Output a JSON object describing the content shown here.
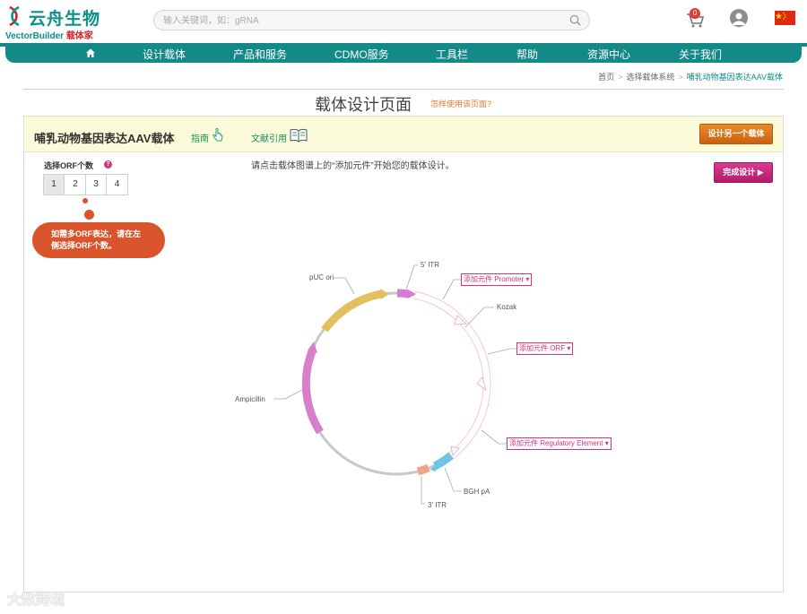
{
  "brand": {
    "cn": "云舟生物",
    "en": "VectorBuilder",
    "en_suffix": "载体家",
    "color": "#0e8f8a"
  },
  "search": {
    "placeholder": "输入关键词，如：gRNA"
  },
  "cart": {
    "count": "0"
  },
  "nav": {
    "home_icon": "home-icon",
    "items": [
      "设计载体",
      "产品和服务",
      "CDMO服务",
      "工具栏",
      "帮助",
      "资源中心",
      "关于我们"
    ]
  },
  "breadcrumb": {
    "items": [
      "首页",
      "选择载体系统"
    ],
    "current": "哺乳动物基因表达AAV载体"
  },
  "page": {
    "title": "载体设计页面",
    "help_link": "怎样使用该页面?"
  },
  "panel": {
    "title": "哺乳动物基因表达AAV载体",
    "guide": "指南",
    "cite": "文献引用",
    "design_another": "设计另一个载体",
    "orf_label": "选择ORF个数",
    "orf_help": "?",
    "orf_options": [
      "1",
      "2",
      "3",
      "4"
    ],
    "orf_selected": "1",
    "callout": [
      "如需多ORF表达，请在左",
      "侧选择ORF个数。"
    ],
    "instruction": "请点击载体图谱上的“添加元件”开始您的载体设计。",
    "finish": "完成设计 ▶"
  },
  "plasmid": {
    "labels": {
      "puc_ori": "pUC ori",
      "itr5": "5' ITR",
      "kozak": "Kozak",
      "ampicillin": "Ampicillin",
      "bgh": "BGH pA",
      "itr3": "3' ITR"
    },
    "add_buttons": {
      "promoter": "添加元件 Promoter ▾",
      "orf": "添加元件 ORF ▾",
      "regulatory": "添加元件 Regulatory Element ▾"
    },
    "colors": {
      "puc": "#e3c05f",
      "itr": "#d97bd0",
      "amp": "#d77fc7",
      "bgh": "#6fc3e3",
      "itr3": "#f0a58a",
      "placeholder": "#f2a4bd"
    }
  },
  "watermark": "大数跨境"
}
